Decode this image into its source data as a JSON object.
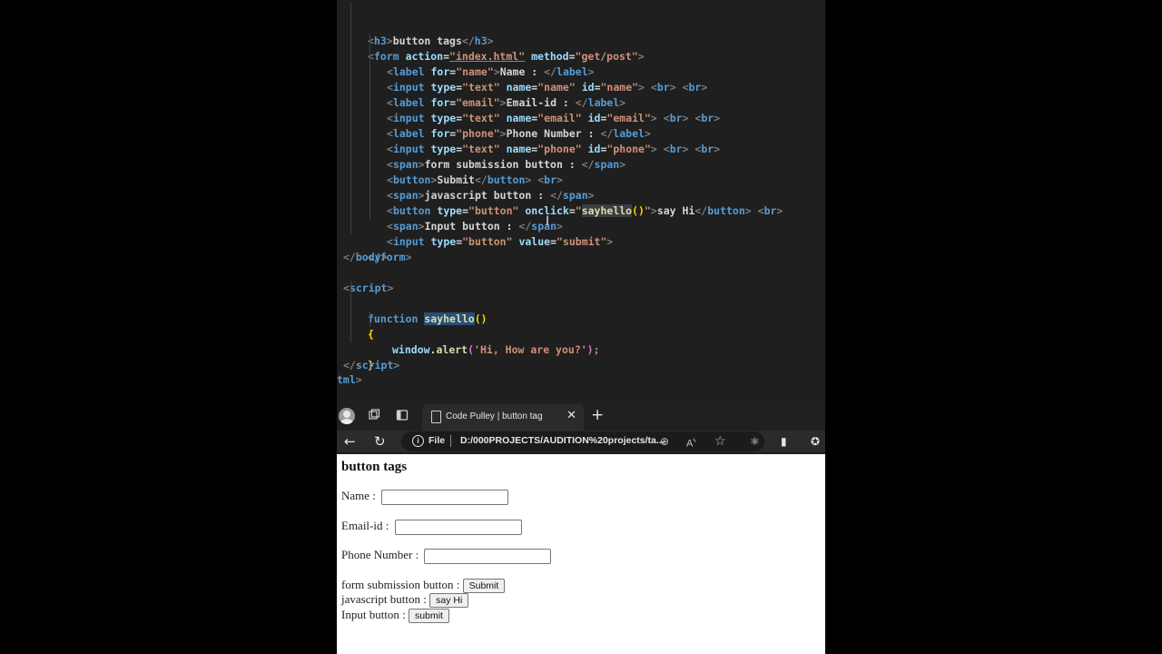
{
  "code": {
    "l1": {
      "a": "<",
      "b": "h3",
      "c": ">",
      "d": "button tags",
      "e": "</",
      "f": "h3",
      "g": ">"
    },
    "l2": {
      "a": "<",
      "b": "form",
      "c": " action",
      "d": "=",
      "e": "\"index.html\"",
      "f": " method",
      "g": "=",
      "h": "\"get/post\"",
      "i": ">"
    },
    "l3": {
      "a": "<",
      "b": "label",
      "c": " for",
      "d": "=",
      "e": "\"name\"",
      "f": ">",
      "g": "Name : ",
      "h": "</",
      "i": "label",
      "j": ">"
    },
    "l4": {
      "a": "<",
      "b": "input",
      "c": " type",
      "d": "=",
      "e": "\"text\"",
      "f": " name",
      "g": "=",
      "h": "\"name\"",
      "i": " id",
      "j": "=",
      "k": "\"name\"",
      "l": ">",
      "m": " <",
      "n": "br",
      "o": ">",
      "p": " <",
      "q": "br",
      "r": ">"
    },
    "l5": {
      "a": "<",
      "b": "label",
      "c": " for",
      "d": "=",
      "e": "\"email\"",
      "f": ">",
      "g": "Email-id : ",
      "h": "</",
      "i": "label",
      "j": ">"
    },
    "l6": {
      "a": "<",
      "b": "input",
      "c": " type",
      "d": "=",
      "e": "\"text\"",
      "f": " name",
      "g": "=",
      "h": "\"email\"",
      "i": " id",
      "j": "=",
      "k": "\"email\"",
      "l": ">",
      "m": " <",
      "n": "br",
      "o": ">",
      "p": " <",
      "q": "br",
      "r": ">"
    },
    "l7": {
      "a": "<",
      "b": "label",
      "c": " for",
      "d": "=",
      "e": "\"phone\"",
      "f": ">",
      "g": "Phone Number : ",
      "h": "</",
      "i": "label",
      "j": ">"
    },
    "l8": {
      "a": "<",
      "b": "input",
      "c": " type",
      "d": "=",
      "e": "\"text\"",
      "f": " name",
      "g": "=",
      "h": "\"phone\"",
      "i": " id",
      "j": "=",
      "k": "\"phone\"",
      "l": ">",
      "m": " <",
      "n": "br",
      "o": ">",
      "p": " <",
      "q": "br",
      "r": ">"
    },
    "l9": {
      "a": "<",
      "b": "span",
      "c": ">",
      "d": "form submission button : ",
      "e": "</",
      "f": "span",
      "g": ">"
    },
    "l10": {
      "a": "<",
      "b": "button",
      "c": ">",
      "d": "Submit",
      "e": "</",
      "f": "button",
      "g": ">",
      "h": " <",
      "i": "br",
      "j": ">"
    },
    "l11": {
      "a": "<",
      "b": "span",
      "c": ">",
      "d": "javascript button : ",
      "e": "</",
      "f": "span",
      "g": ">"
    },
    "l12": {
      "a": "<",
      "b": "button",
      "c": " type",
      "d": "=",
      "e": "\"button\"",
      "f": " onclick",
      "g": "=",
      "h": "\"",
      "i": "sayhello",
      "j": "()",
      "k": "\"",
      "l": ">",
      "m": "say Hi",
      "n": "</",
      "o": "button",
      "p": ">",
      "q": " <",
      "r": "br",
      "s": ">"
    },
    "l13": {
      "a": "<",
      "b": "span",
      "c": ">",
      "d": "Input button : ",
      "e": "</",
      "f": "span",
      "g": ">"
    },
    "l14": {
      "a": "<",
      "b": "input",
      "c": " type",
      "d": "=",
      "e": "\"button\"",
      "f": " value",
      "g": "=",
      "h": "\"submit\"",
      "i": ">"
    },
    "l15": {
      "a": "</",
      "b": "form",
      "c": ">"
    },
    "l16": {
      "a": "</",
      "b": "body",
      "c": ">"
    },
    "l18": {
      "a": "<",
      "b": "script",
      "c": ">"
    },
    "l19": {
      "a": "function",
      "b": " ",
      "c": "sayhello",
      "d": "()"
    },
    "l20": {
      "a": "{"
    },
    "l21": {
      "a": "window",
      "b": ".",
      "c": "alert",
      "d": "(",
      "e": "'Hi, How are you?'",
      "f": ");"
    },
    "l22": {
      "a": "}"
    },
    "l23": {
      "a": "</",
      "b": "script",
      "c": ">"
    },
    "l24": {
      "a": "tml",
      "b": ">"
    }
  },
  "browser": {
    "tab_title": "Code Pulley | button tag",
    "file_label": "File",
    "url": "D:/000PROJECTS/AUDITION%20projects/ta..."
  },
  "page": {
    "heading": "button tags",
    "name_label": "Name :",
    "email_label": "Email-id :",
    "phone_label": "Phone Number :",
    "form_submission_label": "form submission button :",
    "submit_button": "Submit",
    "javascript_label": "javascript button :",
    "say_hi_button": "say Hi",
    "input_button_label": "Input button :",
    "input_button_value": "submit"
  },
  "colors": {
    "editor_bg": "#1f1f1f",
    "tag": "#569cd6",
    "attribute": "#9cdcfe",
    "string": "#ce9178",
    "function": "#dcdcaa",
    "bracket": "#ffd700",
    "selection": "#264f78"
  }
}
